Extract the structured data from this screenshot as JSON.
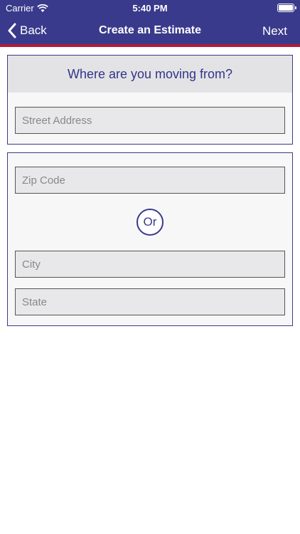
{
  "status_bar": {
    "carrier": "Carrier",
    "time": "5:40 PM"
  },
  "nav": {
    "back_label": "Back",
    "title": "Create an Estimate",
    "next_label": "Next"
  },
  "from_section": {
    "heading": "Where are you moving from?",
    "street_placeholder": "Street Address"
  },
  "location_section": {
    "zip_placeholder": "Zip Code",
    "or_label": "Or",
    "city_placeholder": "City",
    "state_placeholder": "State"
  },
  "colors": {
    "brand_purple": "#3a3a8c",
    "accent_red": "#b01c3a"
  }
}
